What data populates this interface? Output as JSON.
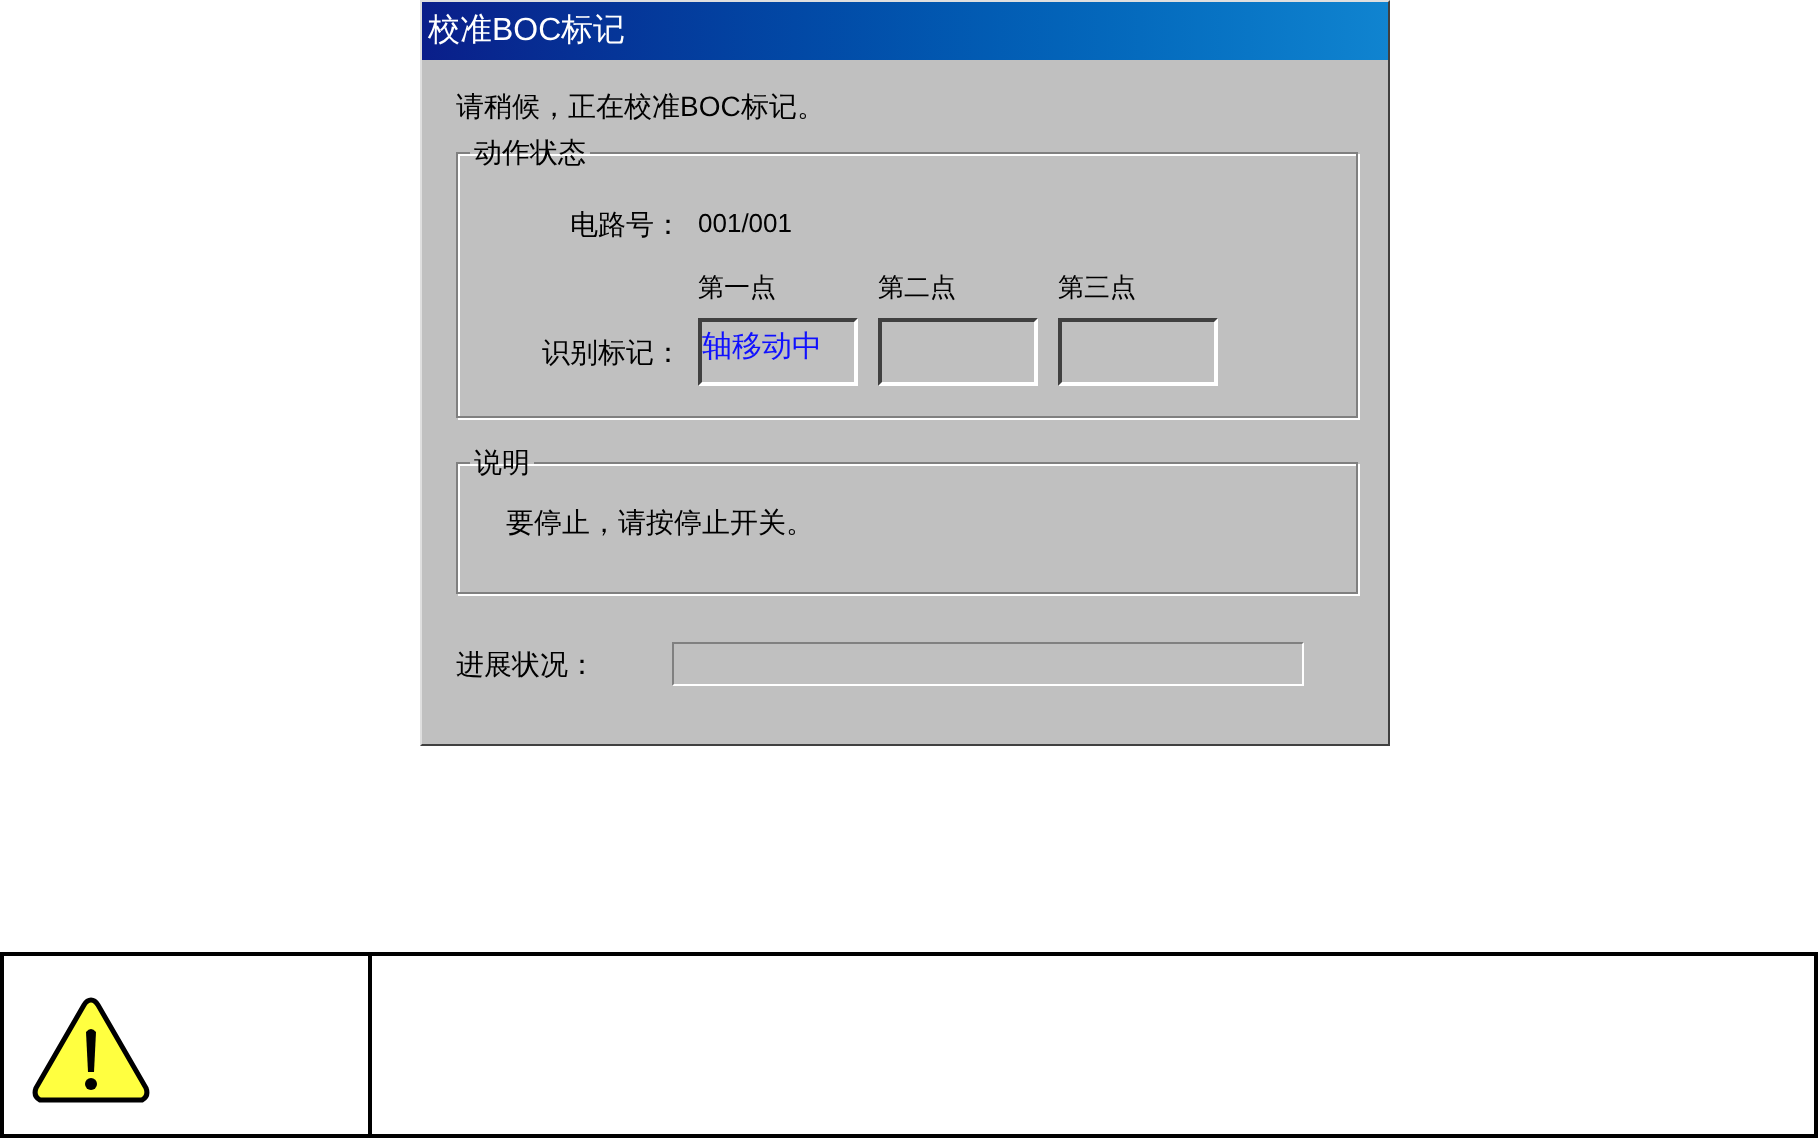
{
  "window": {
    "title": "校准BOC标记"
  },
  "message": "请稍候，正在校准BOC标记。",
  "action_status": {
    "title": "动作状态",
    "circuit_label": "电路号：",
    "circuit_value": "001/001",
    "mark_label": "识别标记：",
    "points": [
      {
        "label": "第一点",
        "value": "轴移动中"
      },
      {
        "label": "第二点"
      },
      {
        "label": "第三点"
      }
    ]
  },
  "description": {
    "title": "说明",
    "text": "要停止，请按停止开关。"
  },
  "progress": {
    "label": "进展状况：",
    "level": 0
  },
  "notice_table": {
    "icon_cell": {
      "kind": "warning"
    }
  }
}
